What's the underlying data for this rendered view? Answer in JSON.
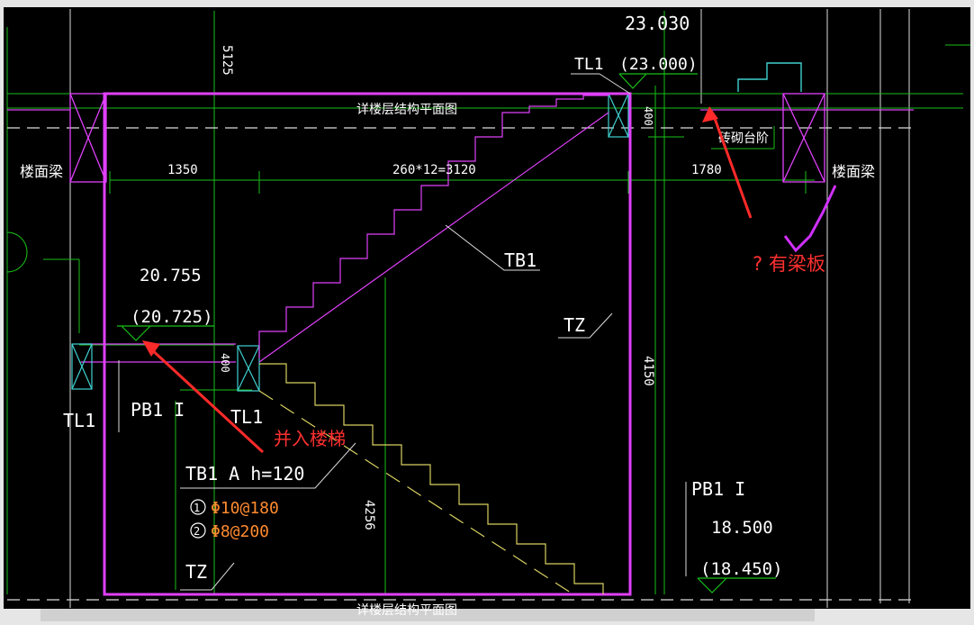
{
  "drawing": {
    "texts": {
      "elev_top": "23.030",
      "elev_top_paren": "(23.000)",
      "dim_5125": "5125",
      "tl1_top": "TL1",
      "ref_plan_top": "详楼层结构平面图",
      "dim_400_right": "400",
      "brick_step": "砖砌台阶",
      "floor_beam_left": "楼面梁",
      "floor_beam_right": "楼面梁",
      "dim_1350": "1350",
      "dim_3120": "260*12=3120",
      "dim_1780": "1780",
      "tb1": "TB1",
      "elev_mid": "20.755",
      "elev_mid_paren": "(20.725)",
      "tz_mid": "TZ",
      "dim_400_left": "400",
      "dim_4150": "4150",
      "pb1_left": "PB1 I",
      "tl1_left": "TL1",
      "tl1_center": "TL1",
      "tb1_spec": "TB1 A h=120",
      "rebar1_num": "1",
      "rebar1": "Φ10@180",
      "rebar2_num": "2",
      "rebar2": "Φ8@200",
      "dim_4256": "4256",
      "tz_bottom": "TZ",
      "pb1_right": "PB1 I",
      "elev_bottom": "18.500",
      "elev_bottom_paren": "(18.450)",
      "ref_plan_bottom": "详楼层结构平面图"
    },
    "annotations": {
      "question_beam": "? 有梁板",
      "merge_stair": "并入楼梯"
    },
    "colors": {
      "background": "#000000",
      "stair_outline": "#e040fb",
      "dimension": "#18c018",
      "text": "#ffffff",
      "step_yellow": "#d8d060",
      "rebar": "#ff8a30",
      "annotation": "#ff3030",
      "cyan": "#40d0d0"
    }
  }
}
